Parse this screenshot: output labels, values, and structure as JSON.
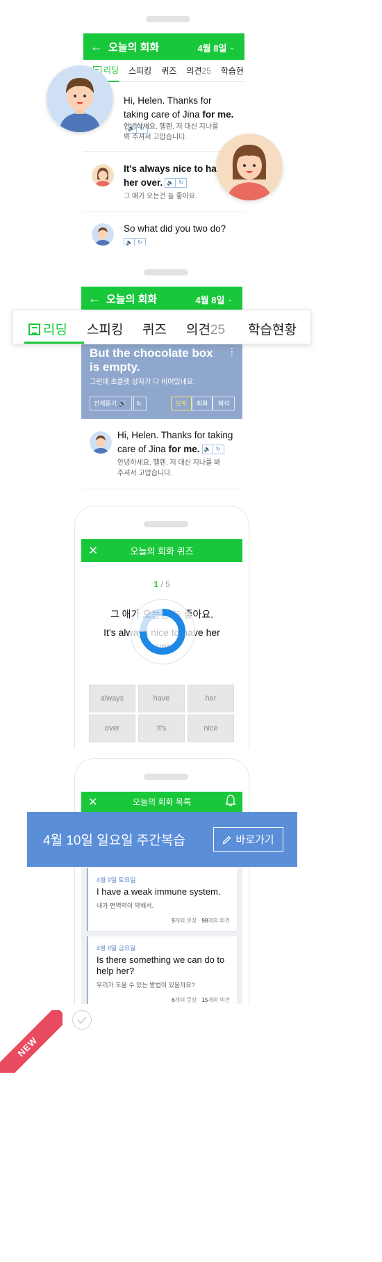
{
  "screen1": {
    "title": "오늘의 회화",
    "date": "4월 8일",
    "tabs": [
      {
        "label": "리딩",
        "count": ""
      },
      {
        "label": "스피킹",
        "count": ""
      },
      {
        "label": "퀴즈",
        "count": ""
      },
      {
        "label": "의견",
        "count": "25"
      },
      {
        "label": "학습현",
        "count": ""
      }
    ],
    "messages": [
      {
        "en_pre": "Hi, Helen. Thanks for taking care of Jina ",
        "en_bold": "for me.",
        "ko": "안녕하세요. 헬렌. 저 대신 지나를 봐 주셔서 고맙습니다."
      },
      {
        "en_bold": "It's always nice to have her over.",
        "ko": "그 애가 오는건 늘 좋아요."
      },
      {
        "en_pre": "So what did you two do?",
        "ko": ""
      }
    ]
  },
  "screen2": {
    "title": "오늘의 회화",
    "date": "4월 8일",
    "tabs": [
      {
        "label": "리딩",
        "count": ""
      },
      {
        "label": "스피킹",
        "count": ""
      },
      {
        "label": "퀴즈",
        "count": ""
      },
      {
        "label": "의견",
        "count": "25"
      },
      {
        "label": "학습현황",
        "count": ""
      }
    ],
    "hero": {
      "en": "But the chocolate box is empty.",
      "ko": "그런데 초콜렛 상자가 다 비어있네요.",
      "listen_all": "전체듣기",
      "segments": [
        "모두",
        "회화",
        "해석"
      ]
    },
    "message": {
      "en_pre": "Hi, Helen. Thanks for taking care of Jina ",
      "en_bold": "for me.",
      "ko": "안녕하세요. 헬렌. 저 대신 지나를 봐 주셔서 고맙습니다."
    }
  },
  "screen3": {
    "title": "오늘의 회화 퀴즈",
    "progress_current": "1",
    "progress_total": "/ 5",
    "question_ko": "그 애가 오는건 늘 좋아요.",
    "answer_en": "It's always nice to have her over.",
    "words": [
      "always",
      "have",
      "her",
      "over",
      "It's",
      "nice"
    ],
    "progress_ring": 0.75
  },
  "screen4": {
    "title": "오늘의 회화 목록",
    "banner_text": "4월 10일 일요일 주간복습",
    "banner_button": "바로가기",
    "cards": [
      {
        "date": "4월 9일 토요일",
        "en": "I have a weak immune system.",
        "ko": "내가 면역력이 약해서.",
        "sentences": "9",
        "sentences_label": "개의 문장",
        "opinions": "98",
        "opinions_label": "개의 의견"
      },
      {
        "date": "4월 8일 금요일",
        "en": "Is there something we can do to help her?",
        "ko": "우리가 도울 수 있는 방법이 있을까요?",
        "sentences": "6",
        "sentences_label": "개의 문장",
        "opinions": "15",
        "opinions_label": "개의 의견"
      }
    ]
  },
  "ribbon": {
    "label": "NEW"
  },
  "colors": {
    "green": "#19c83a",
    "blue_banner": "#5b8ed9",
    "hero_blue": "#8fa7cc",
    "ribbon_red": "#e84a5f",
    "ring_blue": "#1e88e5"
  }
}
